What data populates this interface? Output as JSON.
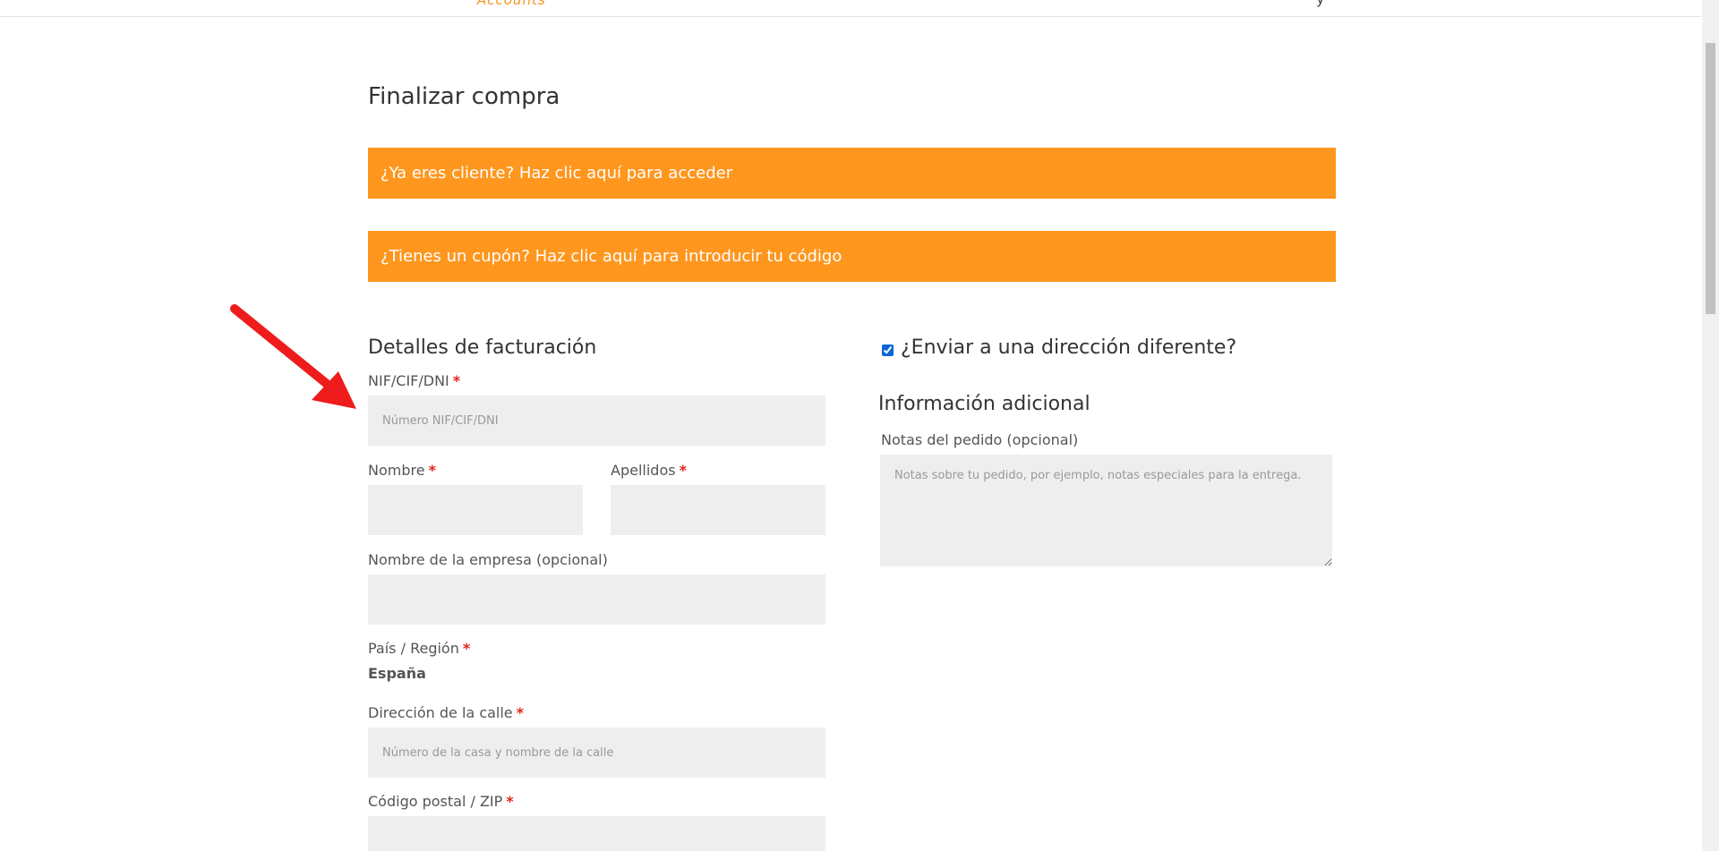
{
  "header": {
    "logo_fragment": "Accounts",
    "menu_fragment": "y"
  },
  "page_title": "Finalizar compra",
  "notices": {
    "login": "¿Ya eres cliente? Haz clic aquí para acceder",
    "coupon": "¿Tienes un cupón? Haz clic aquí para introducir tu código"
  },
  "billing": {
    "title": "Detalles de facturación",
    "nif_label": "NIF/CIF/DNI",
    "nif_placeholder": "Número NIF/CIF/DNI",
    "first_name_label": "Nombre",
    "last_name_label": "Apellidos",
    "company_label": "Nombre de la empresa (opcional)",
    "country_label": "País / Región",
    "country_value": "España",
    "street_label": "Dirección de la calle",
    "street_placeholder": "Número de la casa y nombre de la calle",
    "postcode_label": "Código postal / ZIP",
    "required_mark": "*"
  },
  "shipping": {
    "ship_different_label": "¿Enviar a una dirección diferente?",
    "ship_different_checked": true
  },
  "additional": {
    "title": "Información adicional",
    "notes_label": "Notas del pedido (opcional)",
    "notes_placeholder": "Notas sobre tu pedido, por ejemplo, notas especiales para la entrega."
  },
  "colors": {
    "notice_bg": "#ff961e",
    "input_bg": "#eeeeee",
    "required": "#e2231a",
    "annotation_arrow": "#ee1c1c"
  }
}
